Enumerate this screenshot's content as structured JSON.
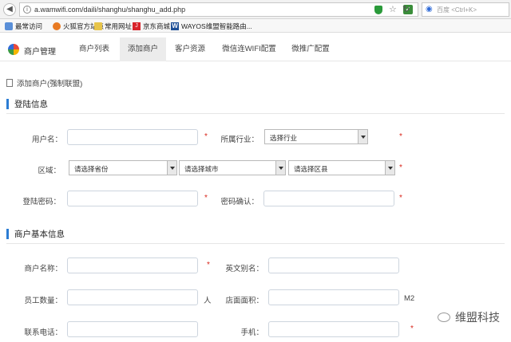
{
  "browser": {
    "url": "a.wamwifi.com/daili/shanghu/shanghu_add.php",
    "search_placeholder": "百度 <Ctrl+K>",
    "bookmarks": [
      {
        "label": "最常访问",
        "icon": "bookmark-icon"
      },
      {
        "label": "火狐官方站点",
        "icon": "firefox-icon"
      },
      {
        "label": "常用网址",
        "icon": "folder-icon"
      },
      {
        "label": "京东商城",
        "icon": "jd-icon"
      },
      {
        "label": "WAYOS维盟智能路由...",
        "icon": "wayos-icon"
      }
    ]
  },
  "nav": {
    "brand": "商户管理",
    "tabs": [
      {
        "label": "商户列表"
      },
      {
        "label": "添加商户"
      },
      {
        "label": "客户资源"
      },
      {
        "label": "微信连WIFI配置"
      },
      {
        "label": "微推广配置"
      }
    ],
    "active_tab": "添加商户"
  },
  "page": {
    "breadcrumb": "添加商户(强制联盟)",
    "sections": {
      "login": {
        "title": "登陆信息",
        "username_label": "用户名：",
        "industry_label": "所属行业：",
        "industry_value": "选择行业",
        "region_label": "区域：",
        "province_value": "请选择省份",
        "city_value": "请选择城市",
        "district_value": "请选择区县",
        "password_label": "登陆密码：",
        "confirm_label": "密码确认："
      },
      "basic": {
        "title": "商户基本信息",
        "merchant_name_label": "商户名称：",
        "english_name_label": "英文别名：",
        "staff_label": "员工数量：",
        "staff_unit": "人",
        "area_label": "店面面积：",
        "area_unit": "M2",
        "phone_label": "联系电话：",
        "mobile_label": "手机："
      }
    },
    "required_mark": "*"
  },
  "watermark": "维盟科技",
  "colors": {
    "accent": "#2b7cd3",
    "required": "#d9261c",
    "active_tab_bg": "#ececec"
  }
}
